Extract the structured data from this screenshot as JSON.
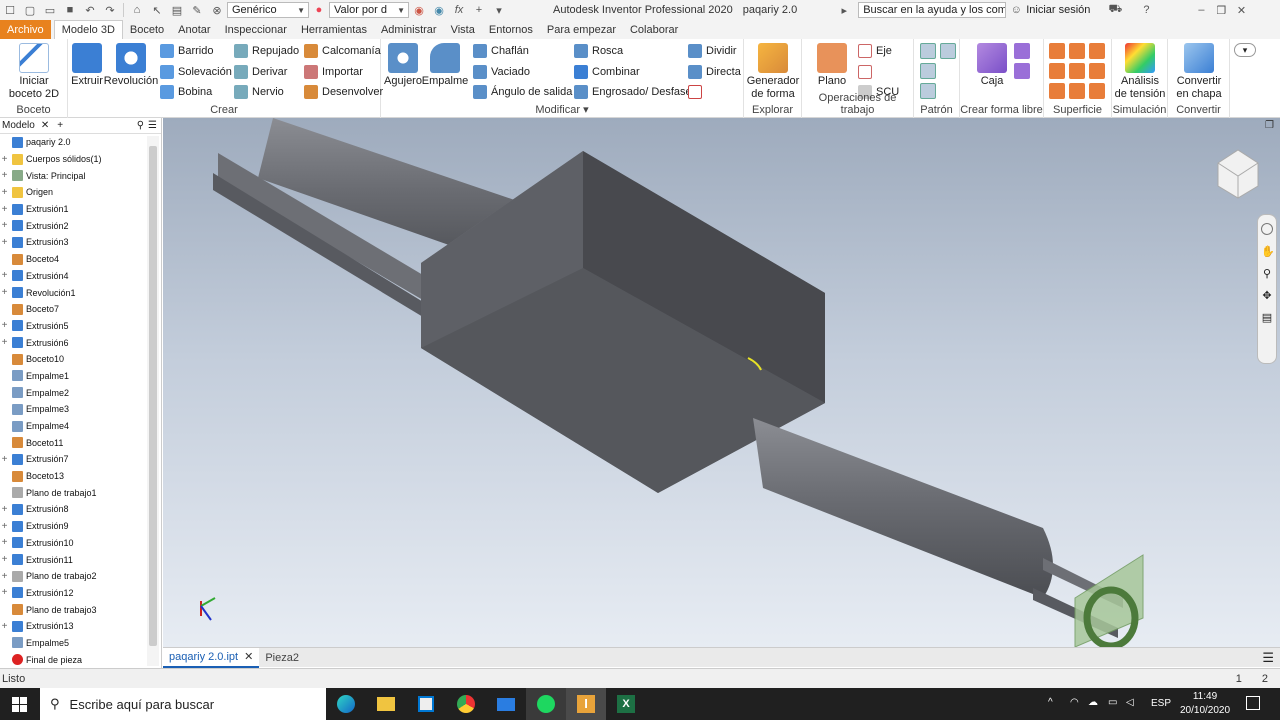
{
  "qat": {
    "material": "Genérico",
    "appearance": "Valor por d",
    "title": "Autodesk Inventor Professional 2020",
    "doc": "paqariy 2.0",
    "search_placeholder": "Buscar en la ayuda y los comandos",
    "signin": "Iniciar sesión"
  },
  "tabs": [
    "Archivo",
    "Modelo 3D",
    "Boceto",
    "Anotar",
    "Inspeccionar",
    "Herramientas",
    "Administrar",
    "Vista",
    "Entornos",
    "Para empezar",
    "Colaborar"
  ],
  "ribbon": {
    "boceto": {
      "label": "Boceto",
      "start": "Iniciar boceto 2D"
    },
    "crear": {
      "label": "Crear",
      "extrude": "Extruir",
      "revolve": "Revolución",
      "sweep": "Barrido",
      "loft": "Solevación",
      "coil": "Bobina",
      "emboss": "Repujado",
      "derive": "Derivar",
      "rib": "Nervio",
      "decal": "Calcomanía",
      "import": "Importar",
      "unwrap": "Desenvolver"
    },
    "modificar": {
      "label": "Modificar",
      "hole": "Agujero",
      "fillet": "Empalme",
      "chamfer": "Chaflán",
      "shell": "Vaciado",
      "draft": "Ángulo de salida",
      "thread": "Rosca",
      "combine": "Combinar",
      "thicken": "Engrosado/ Desfase",
      "split": "Dividir",
      "direct": "Directa"
    },
    "explorar": {
      "label": "Explorar",
      "shape_gen": "Generador de forma"
    },
    "trabajo": {
      "label": "Operaciones de trabajo",
      "plane": "Plano",
      "axis": "Eje",
      "ucs": "SCU"
    },
    "patron": {
      "label": "Patrón"
    },
    "libre": {
      "label": "Crear forma libre",
      "box": "Caja"
    },
    "superficie": {
      "label": "Superficie"
    },
    "simulacion": {
      "label": "Simulación",
      "stress": "Análisis de tensión"
    },
    "convertir": {
      "label": "Convertir",
      "sheet": "Convertir en chapa"
    }
  },
  "browser": {
    "tab": "Modelo",
    "items": [
      {
        "label": "paqariy 2.0",
        "type": "part",
        "exp": ""
      },
      {
        "label": "Cuerpos sólidos(1)",
        "type": "folder",
        "exp": "+"
      },
      {
        "label": "Vista: Principal",
        "type": "view",
        "exp": "+"
      },
      {
        "label": "Origen",
        "type": "folder",
        "exp": "+"
      },
      {
        "label": "Extrusión1",
        "type": "extrude",
        "exp": "+"
      },
      {
        "label": "Extrusión2",
        "type": "extrude",
        "exp": "+"
      },
      {
        "label": "Extrusión3",
        "type": "extrude",
        "exp": "+"
      },
      {
        "label": "Boceto4",
        "type": "sketch",
        "exp": ""
      },
      {
        "label": "Extrusión4",
        "type": "extrude",
        "exp": "+"
      },
      {
        "label": "Revolución1",
        "type": "revolve",
        "exp": "+"
      },
      {
        "label": "Boceto7",
        "type": "sketch",
        "exp": ""
      },
      {
        "label": "Extrusión5",
        "type": "extrude",
        "exp": "+"
      },
      {
        "label": "Extrusión6",
        "type": "extrude",
        "exp": "+"
      },
      {
        "label": "Boceto10",
        "type": "sketch",
        "exp": ""
      },
      {
        "label": "Empalme1",
        "type": "fillet",
        "exp": ""
      },
      {
        "label": "Empalme2",
        "type": "fillet",
        "exp": ""
      },
      {
        "label": "Empalme3",
        "type": "fillet",
        "exp": ""
      },
      {
        "label": "Empalme4",
        "type": "fillet",
        "exp": ""
      },
      {
        "label": "Boceto11",
        "type": "sketch",
        "exp": ""
      },
      {
        "label": "Extrusión7",
        "type": "extrude",
        "exp": "+"
      },
      {
        "label": "Boceto13",
        "type": "sketch",
        "exp": ""
      },
      {
        "label": "Plano de trabajo1",
        "type": "plane",
        "exp": ""
      },
      {
        "label": "Extrusión8",
        "type": "extrude",
        "exp": "+"
      },
      {
        "label": "Extrusión9",
        "type": "extrude",
        "exp": "+"
      },
      {
        "label": "Extrusión10",
        "type": "extrude",
        "exp": "+"
      },
      {
        "label": "Extrusión11",
        "type": "extrude",
        "exp": "+"
      },
      {
        "label": "Plano de trabajo2",
        "type": "plane",
        "exp": "+"
      },
      {
        "label": "Extrusión12",
        "type": "extrude",
        "exp": "+"
      },
      {
        "label": "Plano de trabajo3",
        "type": "plane2",
        "exp": ""
      },
      {
        "label": "Extrusión13",
        "type": "extrude",
        "exp": "+"
      },
      {
        "label": "Empalme5",
        "type": "fillet",
        "exp": ""
      },
      {
        "label": "Final de pieza",
        "type": "end",
        "exp": ""
      }
    ]
  },
  "doctabs": [
    "paqariy 2.0.ipt",
    "Pieza2"
  ],
  "status": {
    "text": "Listo",
    "n1": "1",
    "n2": "2"
  },
  "taskbar": {
    "search": "Escribe aquí para buscar",
    "lang": "ESP",
    "time": "11:49",
    "date": "20/10/2020"
  },
  "colors": {
    "accent": "#e8821e",
    "blue": "#1a5fb4",
    "extrude": "#3b7fd4",
    "sketch": "#d88a3a"
  }
}
